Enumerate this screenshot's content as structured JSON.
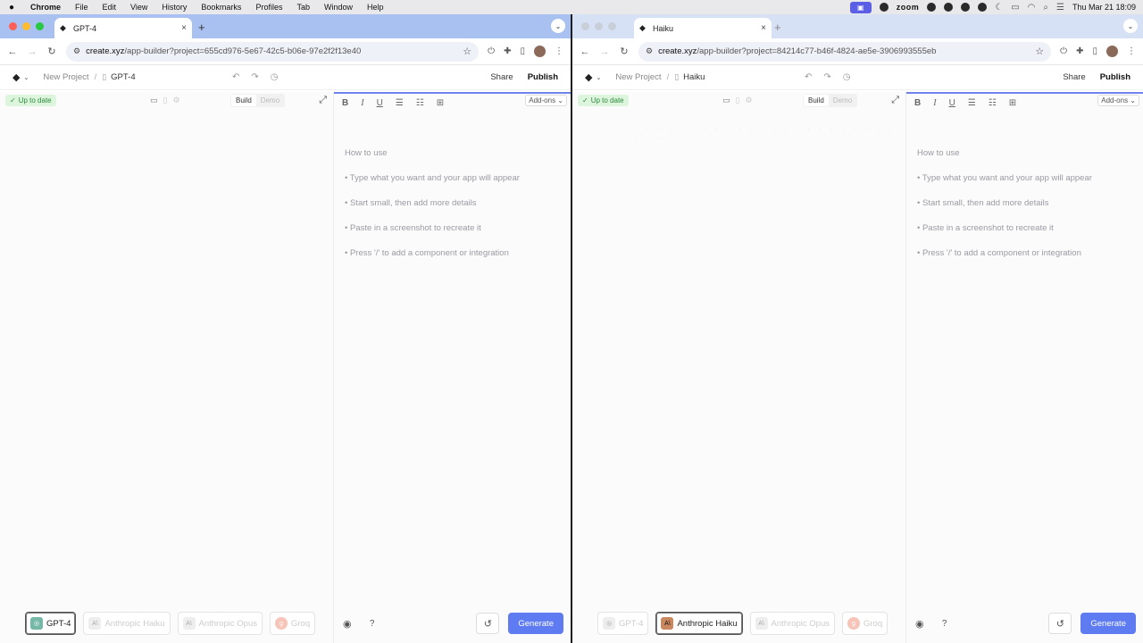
{
  "menubar": {
    "apple_icon": "apple-icon",
    "items": [
      "Chrome",
      "File",
      "Edit",
      "View",
      "History",
      "Bookmarks",
      "Profiles",
      "Tab",
      "Window",
      "Help"
    ],
    "zoom_label": "zoom",
    "datetime": "Thu Mar 21  18:09"
  },
  "windows": [
    {
      "tab_title": "GPT-4",
      "url_host": "create.xyz",
      "url_path": "/app-builder?project=655cd976-5e67-42c5-b06e-97e2f2f13e40",
      "breadcrumb_root": "New Project",
      "breadcrumb_current": "GPT-4",
      "share": "Share",
      "publish": "Publish",
      "status_badge": "Up to date",
      "build": "Build",
      "demo": "Demo",
      "addons": "Add-ons",
      "help": {
        "title": "How to use",
        "items": [
          "• Type what you want and your app will appear",
          "• Start small, then add more details",
          "• Paste in a screenshot to recreate it",
          "• Press '/' to add a component or integration"
        ]
      },
      "models": [
        "GPT-4",
        "Anthropic Haiku",
        "Anthropic Opus",
        "Groq"
      ],
      "active_model": "GPT-4",
      "generate": "Generate"
    },
    {
      "tab_title": "Haiku",
      "url_host": "create.xyz",
      "url_path": "/app-builder?project=84214c77-b46f-4824-ae5e-3906993555eb",
      "breadcrumb_root": "New Project",
      "breadcrumb_current": "Haiku",
      "share": "Share",
      "publish": "Publish",
      "status_badge": "Up to date",
      "build": "Build",
      "demo": "Demo",
      "addons": "Add-ons",
      "help": {
        "title": "How to use",
        "items": [
          "• Type what you want and your app will appear",
          "• Start small, then add more details",
          "• Paste in a screenshot to recreate it",
          "• Press '/' to add a component or integration"
        ]
      },
      "models": [
        "GPT-4",
        "Anthropic Haiku",
        "Anthropic Opus",
        "Groq"
      ],
      "active_model": "Anthropic Haiku",
      "generate": "Generate"
    }
  ],
  "colors": {
    "accent": "#5e7bf2",
    "status_green": "#2e8a3e",
    "tabstrip_active": "#a9c1f0"
  }
}
